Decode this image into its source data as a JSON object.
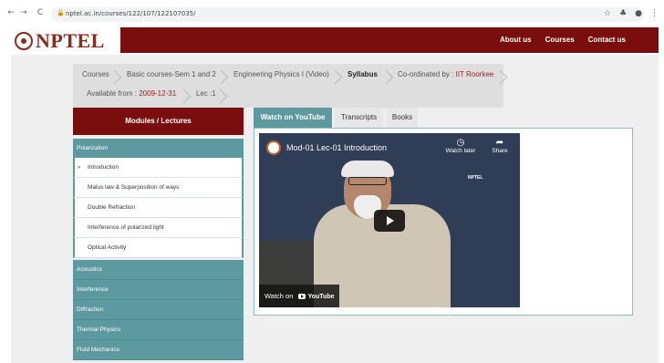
{
  "browser": {
    "url": "nptel.ac.in/courses/122/107/122107035/",
    "back": "←",
    "forward": "→",
    "reload": "C",
    "lock": "🔒",
    "icons": {
      "bookmark": "☆",
      "extensions": "♣",
      "profile": "●",
      "menu": "⋮"
    }
  },
  "header": {
    "logo_text": "NPTEL",
    "nav": [
      "About us",
      "Courses",
      "Contact us"
    ]
  },
  "breadcrumb": {
    "items": [
      "Courses",
      "Basic courses-Sem 1 and 2",
      "Engineering Physics I (Video)",
      "Syllabus"
    ],
    "coordinated_label": "Co-ordinated by : ",
    "coordinated_value": "IIT Roorkee",
    "available_label": "Available from : ",
    "available_value": "2009-12-31",
    "lec": "Lec :1"
  },
  "sidebar": {
    "title": "Modules / Lectures",
    "modules": [
      {
        "label": "Polarization"
      },
      {
        "label": "Acoustics"
      },
      {
        "label": "Interference"
      },
      {
        "label": "Diffraction"
      },
      {
        "label": "Thermal Physics"
      },
      {
        "label": "Fluid Mechanics"
      }
    ],
    "lectures": [
      "Introduction",
      "Malus law & Superposition of ways",
      "Double Refraction",
      "Interference of polarized light",
      "Optical Activity"
    ],
    "bullet": "»"
  },
  "tabs": [
    "Watch on YouTube",
    "Transcripts",
    "Books"
  ],
  "video": {
    "title": "Mod-01 Lec-01 Introduction",
    "watch_later": "Watch later",
    "share": "Share",
    "badge": "NPTEL",
    "watch_on": "Watch on",
    "youtube": "YouTube"
  },
  "colors": {
    "brand": "#7a0e0e",
    "teal": "#5d9aa0",
    "panel": "#efefef"
  }
}
